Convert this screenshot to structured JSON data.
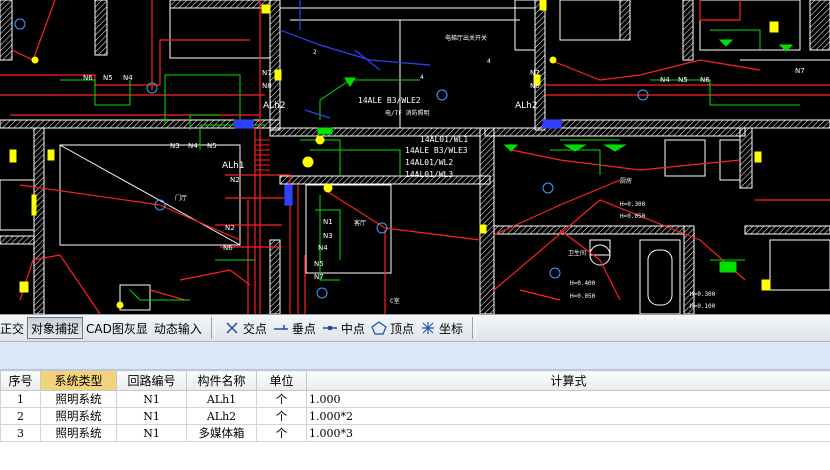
{
  "cad": {
    "labels": {
      "ALh2_left": "ALh2",
      "ALh2_right": "ALh2",
      "ALh1": "ALh1",
      "circuit_ALE_WLE2": "14ALE B3/WLE2",
      "circuit_WL1": "14AL01/WL1",
      "circuit_WLE3": "14ALE B3/WLE3",
      "circuit_WL2": "14AL01/WL2",
      "circuit_WL3": "14AL01/WL3",
      "note_top": "电梯厅出关开关",
      "note_mid": "电/TF 消防照明",
      "room_living": "客厅",
      "room_bath": "卫生间",
      "room_kitchen": "厨房",
      "room_hall": "门厅",
      "room_c": "C室",
      "h1": "H=0.300",
      "h2": "H=0.050",
      "h3": "H=0.400",
      "h4": "H=0.050",
      "h5": "H=0.300",
      "h6": "H=0.100",
      "n1": "N1",
      "n2": "N2",
      "n3": "N3",
      "n4": "N4",
      "n5": "N5",
      "n6": "N6",
      "n7": "N7",
      "n8": "N8",
      "num2": "2",
      "num4": "4"
    }
  },
  "snapbar": {
    "ortho": "正交",
    "object_snap": "对象捕捉",
    "cad_gray": "CAD图灰显",
    "dynamic_input": "动态输入",
    "intersection": "交点",
    "perpendicular": "垂点",
    "midpoint": "中点",
    "vertex": "顶点",
    "coordinate": "坐标"
  },
  "table": {
    "headers": [
      "序号",
      "系统类型",
      "回路编号",
      "构件名称",
      "单位",
      "计算式"
    ],
    "rows": [
      {
        "no": "1",
        "system": "照明系统",
        "circuit": "N1",
        "name": "ALh1",
        "unit": "个",
        "formula": "1.000"
      },
      {
        "no": "2",
        "system": "照明系统",
        "circuit": "N1",
        "name": "ALh2",
        "unit": "个",
        "formula": "1.000*2"
      },
      {
        "no": "3",
        "system": "照明系统",
        "circuit": "N1",
        "name": "多媒体箱",
        "unit": "个",
        "formula": "1.000*3"
      }
    ]
  },
  "colors": {
    "cad_background": "#000000",
    "wall": "#ffffff",
    "wire_red": "#ff2020",
    "wire_green": "#00e000",
    "wire_blue": "#3040ff",
    "fixture_yellow": "#ffff00",
    "selected_header": "#f2d27a"
  }
}
